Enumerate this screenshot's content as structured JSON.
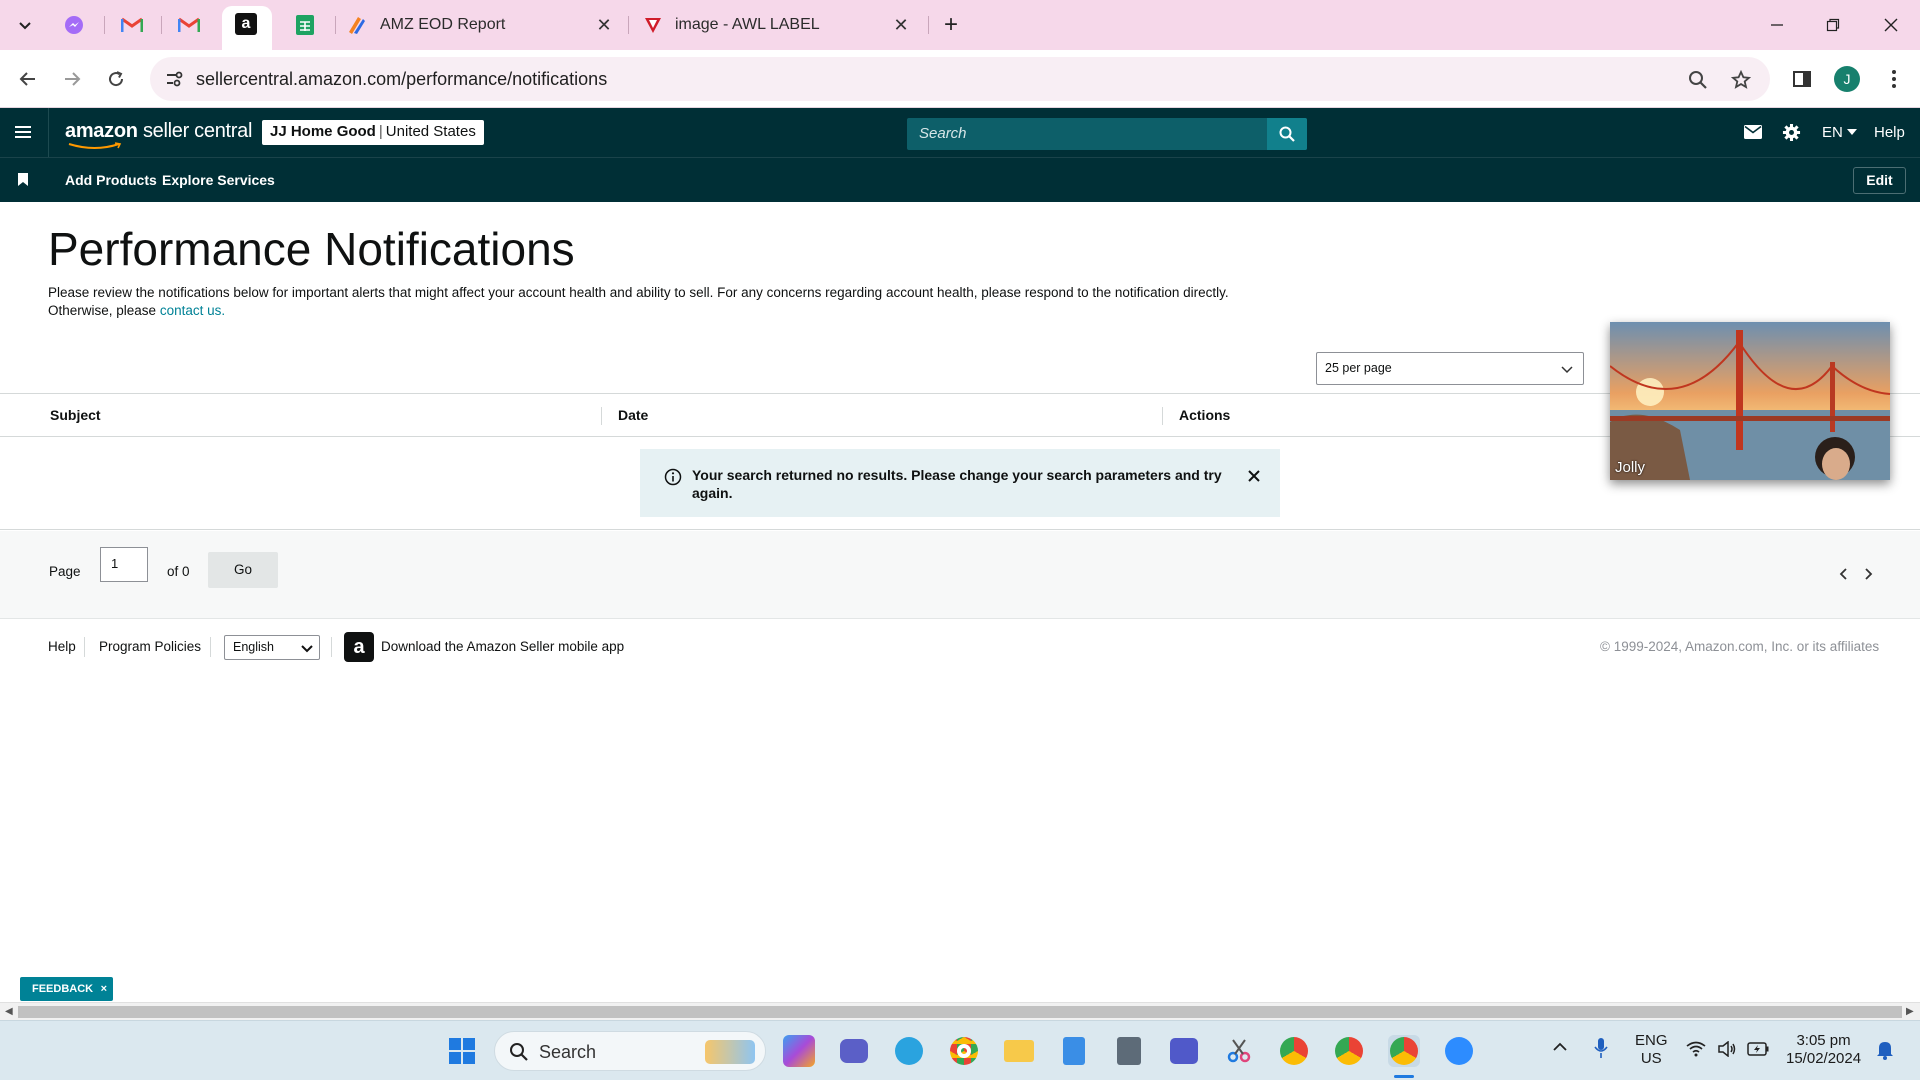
{
  "browser": {
    "tabs": [
      {
        "title": "AMZ EOD Report",
        "icon": "zoho-icon"
      },
      {
        "title": "image - AWL LABEL",
        "icon": "awl-icon"
      }
    ],
    "url": "sellercentral.amazon.com/performance/notifications",
    "profile_initial": "J"
  },
  "header": {
    "logo_bold": "amazon",
    "logo_rest": "seller central",
    "store_name": "JJ Home Good",
    "marketplace": "United States",
    "search_placeholder": "Search",
    "language": "EN",
    "help": "Help"
  },
  "bookmarks": {
    "links": [
      "Add Products",
      "Explore Services"
    ],
    "edit_label": "Edit"
  },
  "main": {
    "title": "Performance Notifications",
    "intro": "Please review the notifications below for important alerts that might affect your account health and ability to sell. For any concerns regarding account health, please respond to the notification directly. Otherwise, please ",
    "contact_link": "contact us.",
    "per_page": "25 per page",
    "columns": [
      "Subject",
      "Date",
      "Actions"
    ],
    "no_results": "Your search returned no results. Please change your search parameters and try again.",
    "pager": {
      "page_label": "Page",
      "page_value": "1",
      "of_label": "of 0",
      "go_label": "Go"
    }
  },
  "footer": {
    "help": "Help",
    "program_policies": "Program Policies",
    "language": "English",
    "app_text": "Download the Amazon Seller mobile app",
    "copyright": "© 1999-2024, Amazon.com, Inc. or its affiliates"
  },
  "video": {
    "participant": "Jolly"
  },
  "feedback": {
    "label": "FEEDBACK",
    "close": "×"
  },
  "taskbar": {
    "search_placeholder": "Search",
    "lang_top": "ENG",
    "lang_bottom": "US",
    "time": "3:05 pm",
    "date": "15/02/2024"
  },
  "colors": {
    "header_bg": "#002f36",
    "accent_teal": "#008296",
    "tab_strip": "#f6d8ea"
  }
}
